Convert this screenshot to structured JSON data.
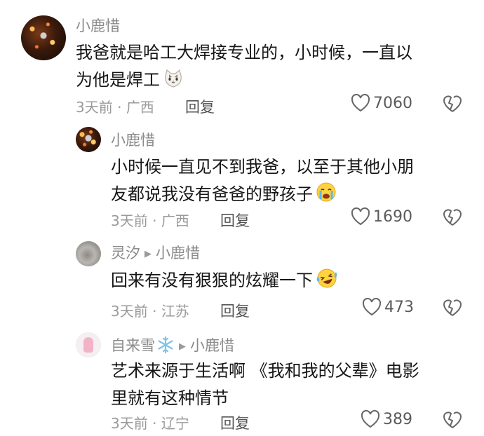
{
  "comments": [
    {
      "author": "小鹿惜",
      "text_line1": "我爸就是哈工大焊接专业的，小时候，一直以",
      "text_line2": "为他是焊工",
      "emoji": "cat-face-icon",
      "time": "3天前",
      "location": "广西",
      "reply_label": "回复",
      "likes": "7060"
    },
    {
      "author": "小鹿惜",
      "text_line1": "小时候一直见不到我爸，以至于其他小朋",
      "text_line2": "友都说我没有爸爸的野孩子",
      "emoji": "crying-face-icon",
      "time": "3天前",
      "location": "广西",
      "reply_label": "回复",
      "likes": "1690"
    },
    {
      "author": "灵汐",
      "reply_to": "小鹿惜",
      "text_line1": "回来有没有狠狠的炫耀一下",
      "emoji": "laughing-tears-icon",
      "time": "3天前",
      "location": "江苏",
      "reply_label": "回复",
      "likes": "473"
    },
    {
      "author": "自来雪",
      "author_emoji": "snowflake-icon",
      "reply_to": "小鹿惜",
      "text_line1": "艺术来源于生活啊 《我和我的父辈》电影",
      "text_line2": "里就有这种情节",
      "time": "3天前",
      "location": "辽宁",
      "reply_label": "回复",
      "likes": "389"
    }
  ],
  "separator": "·",
  "reply_arrow": "▶"
}
